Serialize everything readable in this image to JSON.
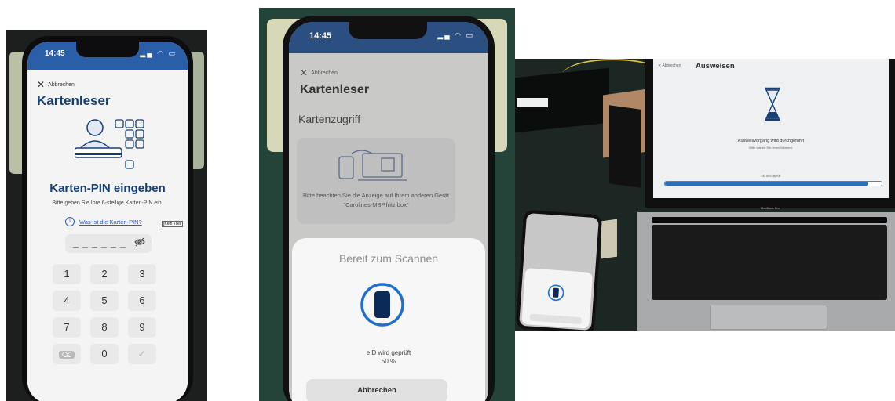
{
  "panel1": {
    "status_time": "14:45",
    "cancel_label": "Abbrechen",
    "title": "Kartenleser",
    "heading": "Karten-PIN eingeben",
    "instruction": "Bitte geben Sie Ihre 6-stellige Karten-PIN ein.",
    "help_link": "Was ist die Karten-PIN?",
    "tooltip": "[Kein Titel]",
    "pin_value": "_ _ _ _ _ _",
    "keypad": [
      "1",
      "2",
      "3",
      "4",
      "5",
      "6",
      "7",
      "8",
      "9",
      "⌫",
      "0",
      "✓"
    ]
  },
  "panel2": {
    "status_time": "14:45",
    "cancel_label": "Abbrechen",
    "title": "Kartenleser",
    "subtitle": "Kartenzugriff",
    "info_message": "Bitte beachten Sie die Anzeige auf Ihrem anderen Gerät \"Carolines-MBP.fritz.box\"",
    "scan_title": "Bereit zum Scannen",
    "scan_status": "eID wird geprüft",
    "scan_progress": "50 %",
    "scan_cancel_button": "Abbrechen"
  },
  "panel3": {
    "cancel_label": "Abbrechen",
    "title": "Ausweisen",
    "progress_message": "Ausweisvorgang wird durchgeführt",
    "wait_message": "Bitte warten Sie einen Moment.",
    "bar_label": "eID wird geprüft",
    "progress": 0.94,
    "device_label": "MacBook Pro"
  },
  "colors": {
    "brand_blue": "#163f74",
    "link_blue": "#2a5bbf",
    "status_bar_blue": "#2b5ea9",
    "chip_blue": "#1f6fd1"
  }
}
